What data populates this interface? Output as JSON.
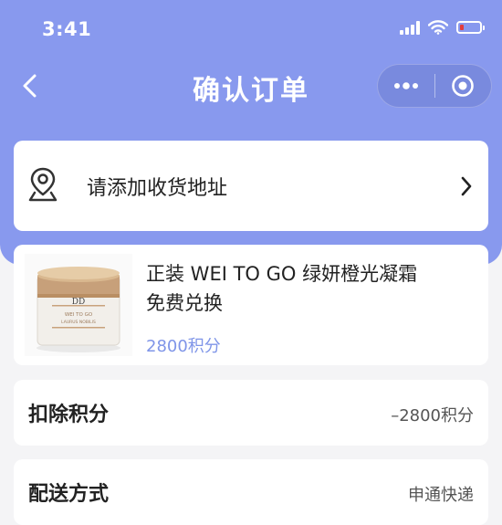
{
  "status_bar": {
    "time": "3:41"
  },
  "nav": {
    "title": "确认订单"
  },
  "address": {
    "label": "请添加收货地址"
  },
  "product": {
    "title": "正装 WEI TO GO 绿妍橙光凝霜 免费兑换",
    "price": "2800积分",
    "image_text_1": "WEI TO GO",
    "image_text_2": "LAURUS NOBILIS",
    "image_brand": "DD"
  },
  "points_row": {
    "label": "扣除积分",
    "value": "–2800积分"
  },
  "delivery_row": {
    "label": "配送方式",
    "value": "申通快递"
  },
  "colors": {
    "header": "#8899ee",
    "price": "#7f95e8",
    "background": "#f4f4f6",
    "battery_low": "#e23c3c"
  },
  "icons": [
    "signal-icon",
    "wifi-icon",
    "battery-icon",
    "back-arrow-icon",
    "more-dots-icon",
    "close-target-icon",
    "location-pin-icon",
    "chevron-right-icon"
  ]
}
